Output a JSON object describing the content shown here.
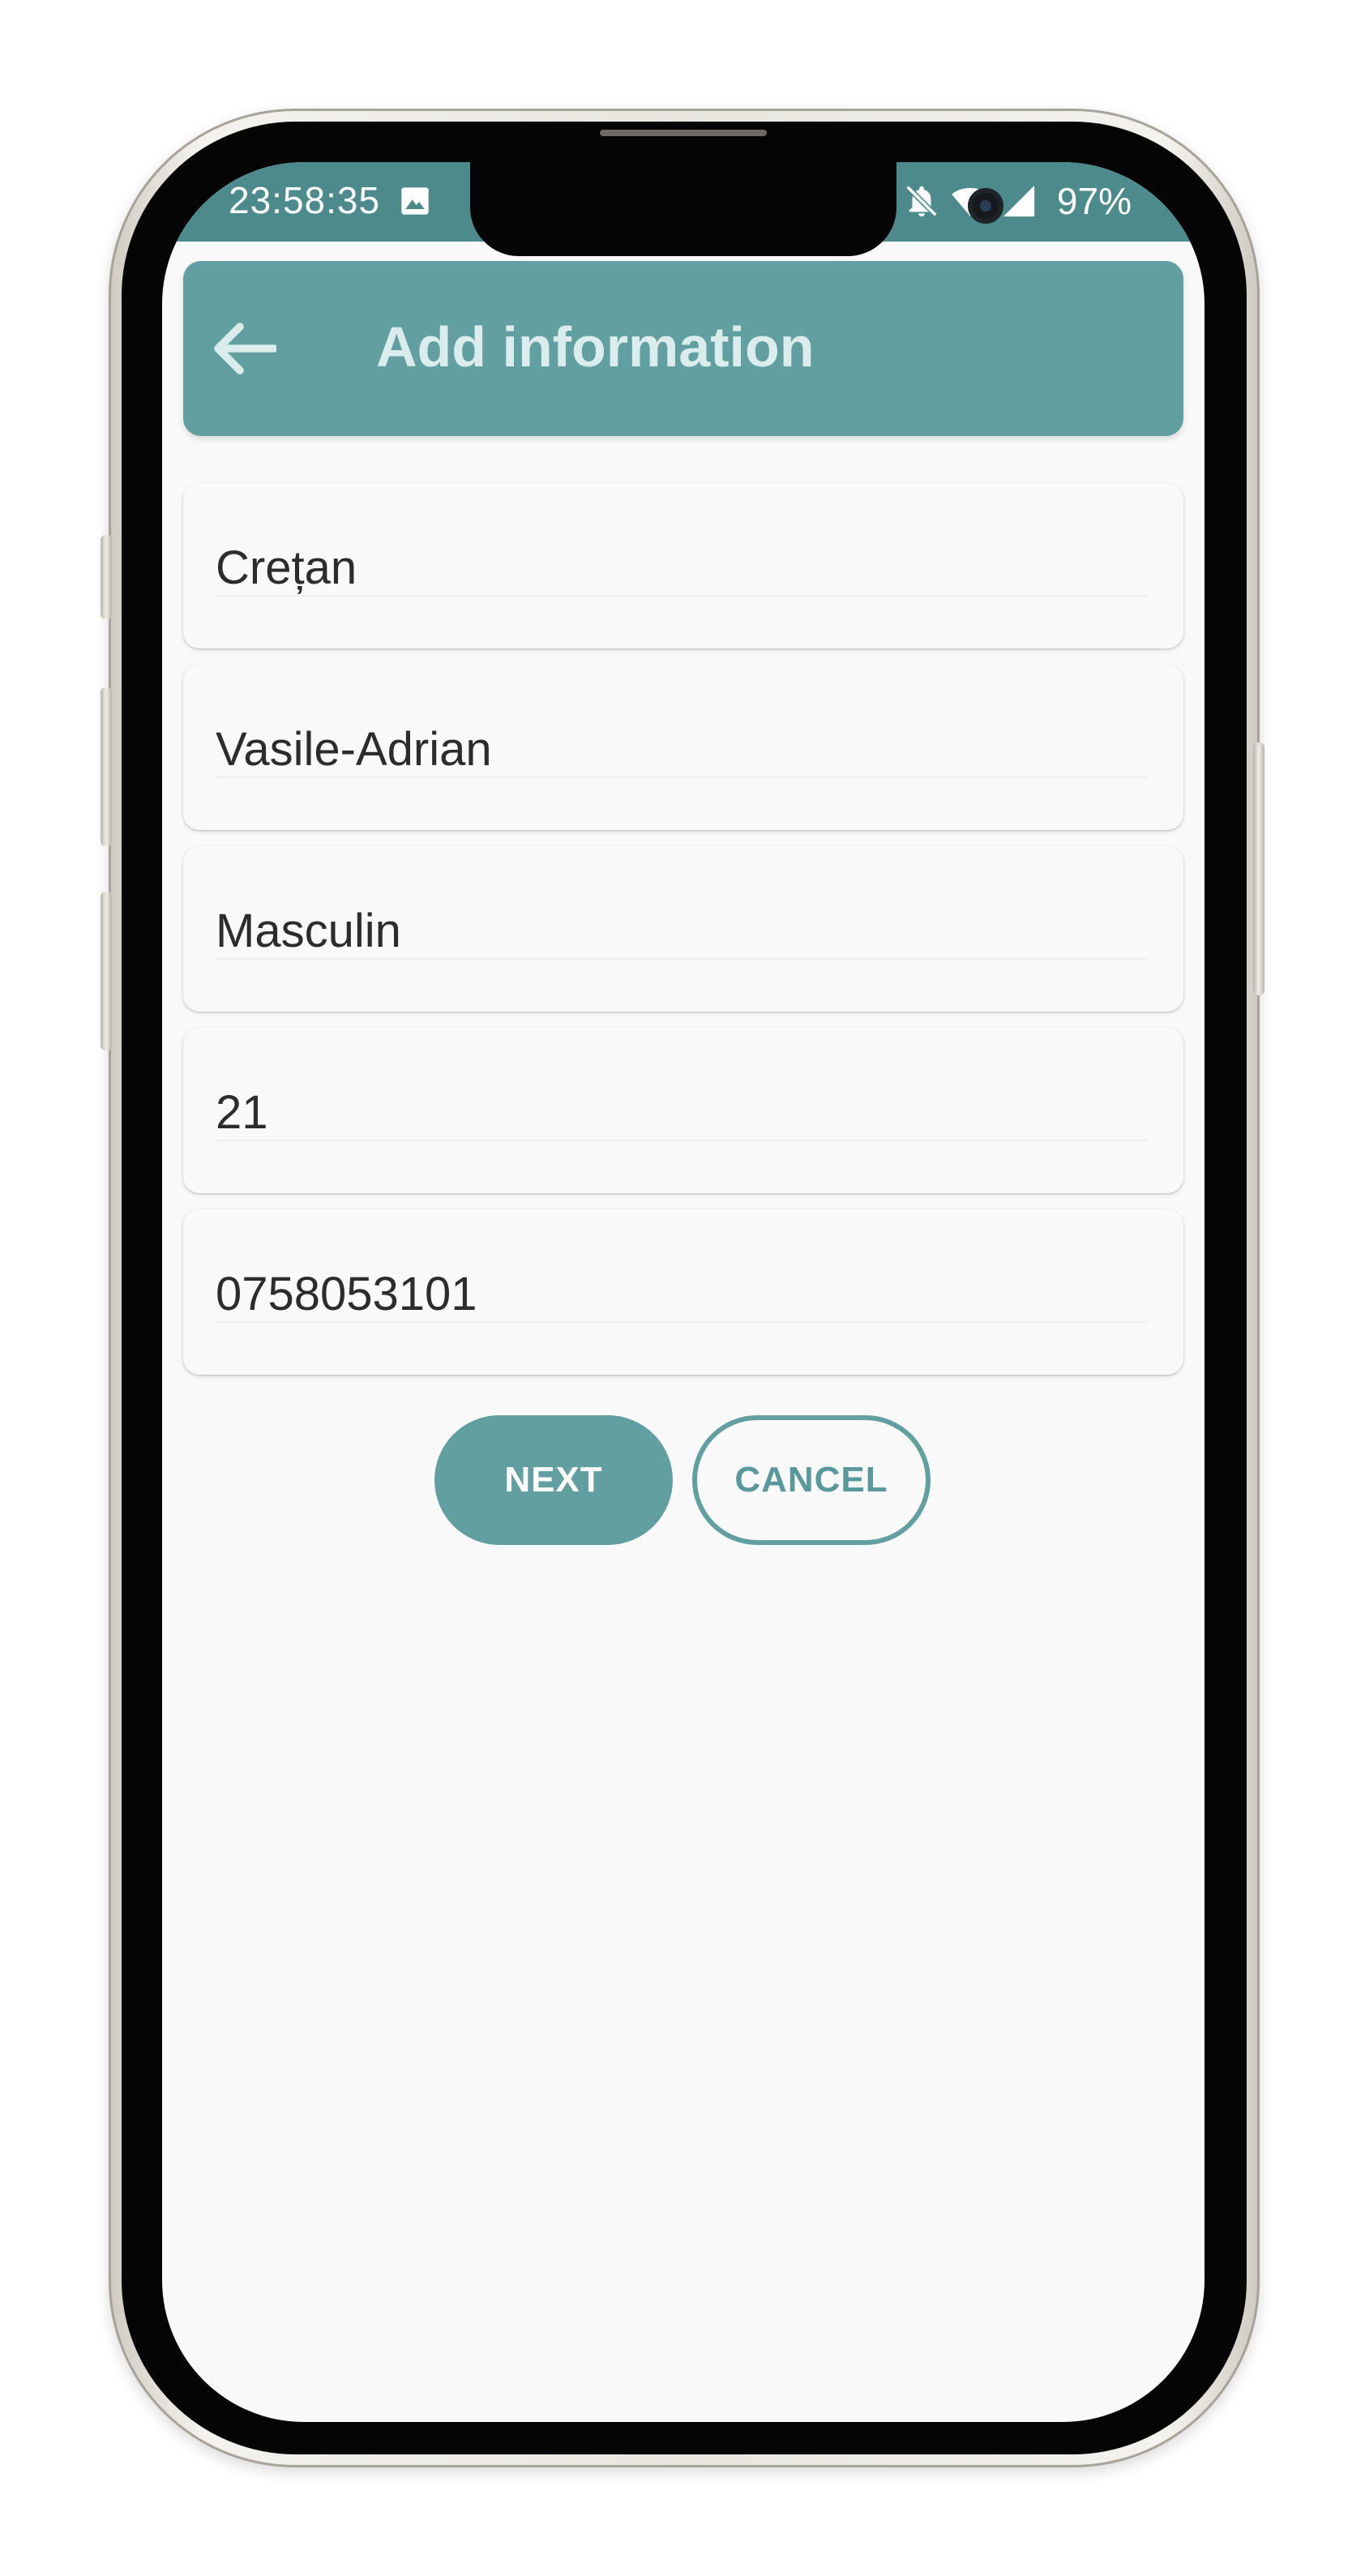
{
  "status_bar": {
    "time": "23:58:35",
    "battery": "97%",
    "icons": [
      "image-icon",
      "bell-off-icon",
      "wifi-icon",
      "signal-icon"
    ]
  },
  "app_bar": {
    "title": "Add information",
    "back_icon": "arrow-left-icon"
  },
  "form": {
    "fields": [
      {
        "value": "Crețan"
      },
      {
        "value": "Vasile-Adrian"
      },
      {
        "value": "Masculin"
      },
      {
        "value": "21"
      },
      {
        "value": "0758053101"
      }
    ]
  },
  "actions": {
    "next_label": "NEXT",
    "cancel_label": "CANCEL"
  },
  "colors": {
    "primary": "#619fa1",
    "status_bar": "#4d8a8b",
    "background": "#f9f9f9",
    "title_text": "#dbecec"
  }
}
